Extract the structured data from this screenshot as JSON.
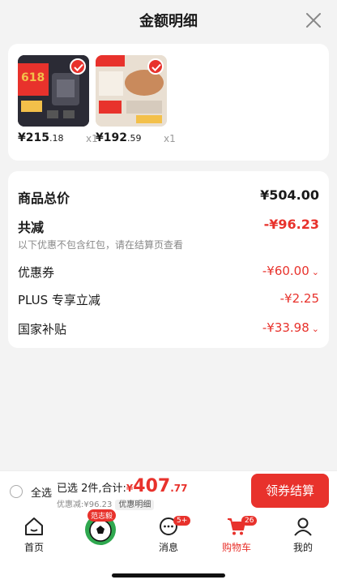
{
  "header": {
    "title": "金额明细"
  },
  "products": [
    {
      "price_int": "¥215",
      "price_dec": ".18",
      "qty": "x1",
      "thumb_colors": [
        "#2b2b35",
        "#e8322c",
        "#f3c04a"
      ]
    },
    {
      "price_int": "¥192",
      "price_dec": ".59",
      "qty": "x1",
      "thumb_colors": [
        "#e9dfd2",
        "#c98a5c",
        "#e8322c"
      ]
    }
  ],
  "summary": {
    "total_label": "商品总价",
    "total_value": "¥504.00",
    "reduce_label": "共减",
    "reduce_value": "-¥96.23",
    "reduce_note": "以下优惠不包含红包，请在结算页查看",
    "coupon_label": "优惠券",
    "coupon_value": "-¥60.00",
    "plus_label": "PLUS 专享立减",
    "plus_value": "-¥2.25",
    "subsidy_label": "国家补贴",
    "subsidy_value": "-¥33.98"
  },
  "bottombar": {
    "select_all": "全选",
    "selected_info": "已选 2件,合计:",
    "currency": "¥",
    "total_int": "407",
    "total_dec": ".77",
    "discount_text": "优惠减:¥96.23",
    "detail_tag": "优惠明细",
    "checkout_label": "领券结算"
  },
  "tabs": [
    {
      "label": "首页",
      "icon": "home-icon"
    },
    {
      "label": "",
      "icon": "football-icon",
      "badge": "范志毅"
    },
    {
      "label": "消息",
      "icon": "message-icon",
      "badge": "5+"
    },
    {
      "label": "购物车",
      "icon": "cart-icon",
      "badge": "26",
      "active": true
    },
    {
      "label": "我的",
      "icon": "profile-icon"
    }
  ],
  "colors": {
    "accent": "#e8322c",
    "text": "#1a1a1a",
    "muted": "#888888"
  }
}
